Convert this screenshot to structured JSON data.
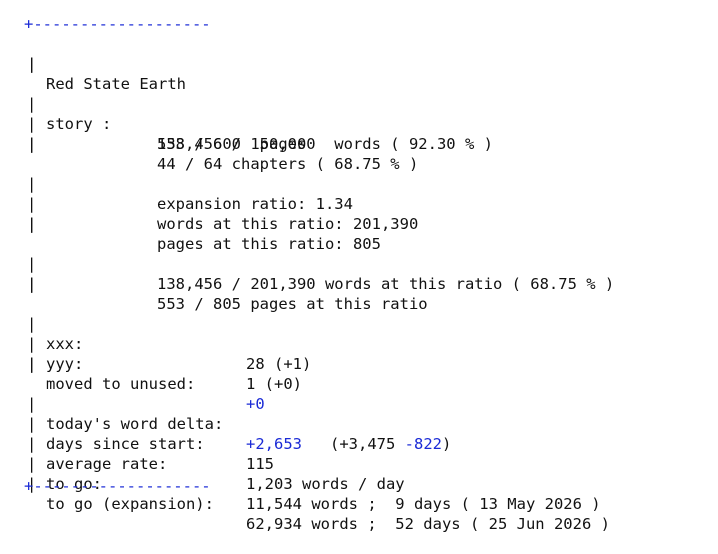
{
  "rule_top": "+-------------------",
  "rule_bottom": "+-------------------",
  "bar": "|",
  "title": "Red State Earth",
  "story": {
    "label": "story :",
    "words_line": "138,456 / 150,000  words ( 92.30 % )",
    "pages_line": "553 / 600  pages",
    "chapters_line": "44 / 64 chapters ( 68.75 % )",
    "expansion_ratio": "expansion ratio: 1.34",
    "words_at_ratio": "words at this ratio: 201,390",
    "pages_at_ratio": "pages at this ratio: 805",
    "progress_words": "138,456 / 201,390 words at this ratio ( 68.75 % )",
    "progress_pages": "553 / 805 pages at this ratio"
  },
  "counters": {
    "xxx_label": "xxx:",
    "xxx_value": "28 (+1)",
    "yyy_label": "yyy:",
    "yyy_value": "1 (+0)",
    "moved_label": "moved to unused:",
    "moved_value": "+0"
  },
  "stats": {
    "delta_label": "today's word delta:",
    "delta_value": "+2,653",
    "delta_open": "(+3,475 ",
    "delta_neg": "-822",
    "delta_close": ")",
    "days_label": "days since start:",
    "days_value": "115",
    "rate_label": "average rate:",
    "rate_value": "1,203 words / day",
    "togo_label": "to go:",
    "togo_value": "11,544 words ;  9 days ( 13 May 2026 )",
    "togo_exp_label": "to go (expansion):",
    "togo_exp_value": "62,934 words ;  52 days ( 25 Jun 2026 )"
  },
  "colors": {
    "accent": "#1a2ad6",
    "text": "#111111",
    "background": "#ffffff"
  }
}
